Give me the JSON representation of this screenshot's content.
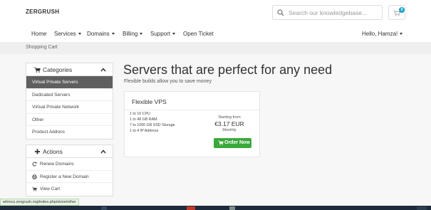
{
  "header": {
    "logo": "ZERGRUSH",
    "search_placeholder": "Search our knowledgebase...",
    "cart_count": "0"
  },
  "nav": {
    "home": "Home",
    "services": "Services",
    "domains": "Domains",
    "billing": "Billing",
    "support": "Support",
    "open_ticket": "Open Ticket",
    "user": "Hello, Hamza!"
  },
  "breadcrumb": "Shopping Cart",
  "categories": {
    "title": "Categories",
    "items": [
      "Virtual Private Servers",
      "Dedicated Servers",
      "Virtual Private Network",
      "Other",
      "Product Addons"
    ]
  },
  "actions": {
    "title": "Actions",
    "items": [
      {
        "label": "Renew Domains",
        "icon": "refresh-icon"
      },
      {
        "label": "Register a New Domain",
        "icon": "globe-icon"
      },
      {
        "label": "View Cart",
        "icon": "cart-icon"
      }
    ]
  },
  "content": {
    "heading": "Servers that are perfect for any need",
    "subheading": "Flexible builds allow you to save money"
  },
  "product": {
    "name": "Flexible VPS",
    "features": [
      "1 to 16 CPU",
      "1 to 48 GB RAM",
      "7 to 1000 GB SSD Storage",
      "1 to 4 IP Address"
    ],
    "starting_from": "Starting from",
    "price": "€3.17 EUR",
    "period": "Monthly",
    "order_label": "Order Now"
  },
  "status_url": "whmcs.zergrush.org/index.php/store/other",
  "colors": {
    "accent_badge": "#1aa3c9",
    "active_item_bg": "#5f5f5f",
    "order_button": "#3aa83a",
    "taskbar": "#1e2b3c"
  }
}
